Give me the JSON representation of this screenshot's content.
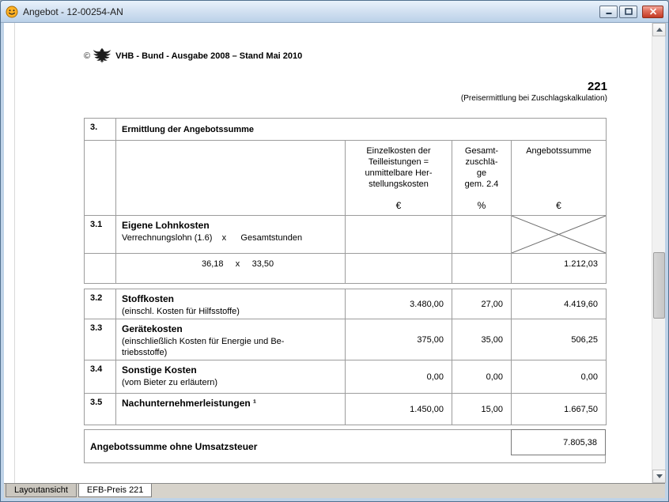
{
  "window": {
    "title": "Angebot - 12-00254-AN"
  },
  "page_header": {
    "copyright": "©",
    "edition": "VHB - Bund - Ausgabe 2008 – Stand Mai 2010",
    "form_number": "221",
    "form_subtitle": "(Preisermittlung bei Zuschlagskalkulation)"
  },
  "table": {
    "section": {
      "num": "3.",
      "title": "Ermittlung der Angebotssumme"
    },
    "headers": {
      "einzelkosten": "Einzelkosten der\nTeilleistungen =\nunmittelbare Her-\nstellungskosten",
      "einzelkosten_unit": "€",
      "zuschlag": "Gesamt-\nzuschlä-\nge\ngem. 2.4",
      "zuschlag_unit": "%",
      "summe": "Angebotssumme",
      "summe_unit": "€"
    },
    "row31": {
      "num": "3.1",
      "title": "Eigene Lohnkosten",
      "subtitle": "Verrechnungslohn (1.6)    x      Gesamtstunden"
    },
    "row31b": {
      "values": "36,18     x     33,50",
      "summe": "1.212,03"
    },
    "rows": [
      {
        "num": "3.2",
        "title": "Stoffkosten",
        "subtitle": "(einschl. Kosten für Hilfsstoffe)",
        "einzel": "3.480,00",
        "zuschlag": "27,00",
        "summe": "4.419,60"
      },
      {
        "num": "3.3",
        "title": "Gerätekosten",
        "subtitle": "(einschließlich Kosten für Energie und Be-\ntriebsstoffe)",
        "einzel": "375,00",
        "zuschlag": "35,00",
        "summe": "506,25"
      },
      {
        "num": "3.4",
        "title": "Sonstige Kosten",
        "subtitle": "(vom Bieter zu erläutern)",
        "einzel": "0,00",
        "zuschlag": "0,00",
        "summe": "0,00"
      },
      {
        "num": "3.5",
        "title": "Nachunternehmerleistungen ¹",
        "subtitle": "",
        "einzel": "1.450,00",
        "zuschlag": "15,00",
        "summe": "1.667,50"
      }
    ],
    "footer": {
      "label": "Angebotssumme ohne Umsatzsteuer",
      "total": "7.805,38"
    }
  },
  "tabs": [
    {
      "label": "Layoutansicht",
      "active": false
    },
    {
      "label": "EFB-Preis 221",
      "active": true
    }
  ]
}
